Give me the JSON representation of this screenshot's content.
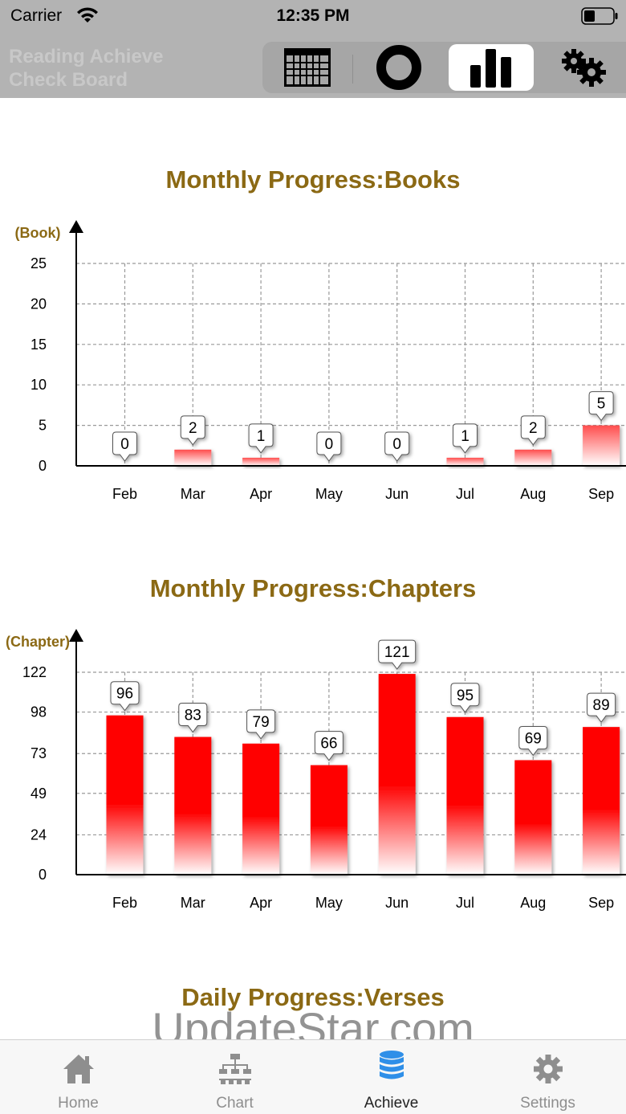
{
  "status_bar": {
    "carrier": "Carrier",
    "time": "12:35 PM"
  },
  "header": {
    "title": "Reading Achieve\nCheck Board",
    "segments": [
      {
        "name": "calendar",
        "icon": "calendar-grid-icon",
        "active": false
      },
      {
        "name": "ring",
        "icon": "ring-icon",
        "active": false
      },
      {
        "name": "bar-chart",
        "icon": "bar-chart-icon",
        "active": true
      },
      {
        "name": "settings",
        "icon": "gears-icon",
        "active": false
      }
    ]
  },
  "charts": {
    "books": {
      "title": "Monthly Progress:Books"
    },
    "chapters": {
      "title": "Monthly Progress:Chapters"
    },
    "verses": {
      "title": "Daily Progress:Verses"
    }
  },
  "chart_data": [
    {
      "type": "bar",
      "title": "Monthly Progress:Books",
      "ylabel": "(Book)",
      "xlabel": "",
      "categories": [
        "Feb",
        "Mar",
        "Apr",
        "May",
        "Jun",
        "Jul",
        "Aug",
        "Sep"
      ],
      "values": [
        0,
        2,
        1,
        0,
        0,
        1,
        2,
        5
      ],
      "yticks": [
        0,
        5,
        10,
        15,
        20,
        25
      ],
      "ylim": [
        0,
        25
      ],
      "grid": true,
      "bar_color": "#ff0000"
    },
    {
      "type": "bar",
      "title": "Monthly Progress:Chapters",
      "ylabel": "(Chapter)",
      "xlabel": "",
      "categories": [
        "Feb",
        "Mar",
        "Apr",
        "May",
        "Jun",
        "Jul",
        "Aug",
        "Sep"
      ],
      "values": [
        96,
        83,
        79,
        66,
        121,
        95,
        69,
        89
      ],
      "yticks": [
        0,
        24,
        49,
        73,
        98,
        122
      ],
      "ylim": [
        0,
        122
      ],
      "grid": true,
      "bar_color": "#ff0000"
    }
  ],
  "watermark": "UpdateStar.com",
  "tab_bar": {
    "tabs": [
      {
        "label": "Home",
        "icon": "home-icon",
        "active": false
      },
      {
        "label": "Chart",
        "icon": "org-chart-icon",
        "active": false
      },
      {
        "label": "Achieve",
        "icon": "database-icon",
        "active": true
      },
      {
        "label": "Settings",
        "icon": "gear-icon",
        "active": false
      }
    ]
  },
  "colors": {
    "title": "#8b6914",
    "bar": "#ff0000",
    "header_bg": "#b3b3b3",
    "achieve_icon": "#2f8fe8"
  }
}
